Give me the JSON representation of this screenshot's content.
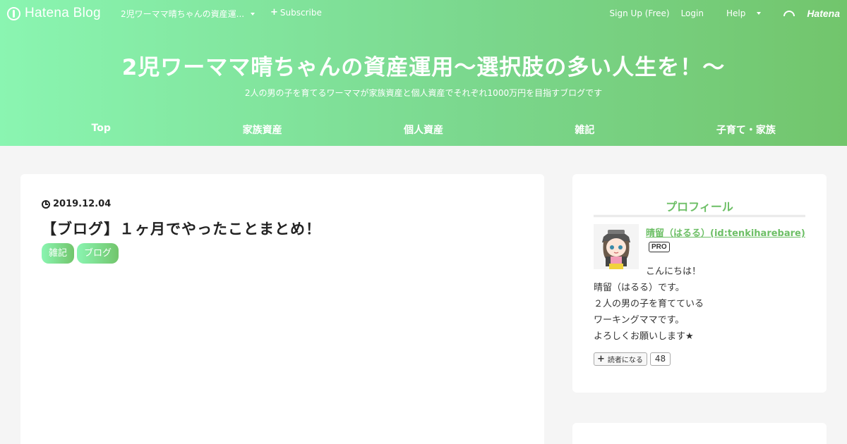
{
  "topbar": {
    "logo_text": "Hatena Blog",
    "blog_name": "2児ワーママ晴ちゃんの資産運...",
    "subscribe": "Subscribe",
    "signup": "Sign Up (Free)",
    "login": "Login",
    "help": "Help",
    "hatena": "Hatena"
  },
  "blog": {
    "title": "2児ワーママ晴ちゃんの資産運用～選択肢の多い人生を！～",
    "description": "2人の男の子を育てるワーママが家族資産と個人資産でそれぞれ1000万円を目指すブログです"
  },
  "nav": [
    "Top",
    "家族資産",
    "個人資産",
    "雑記",
    "子育て・家族"
  ],
  "post": {
    "date": "2019.12.04",
    "title": "【ブログ】１ヶ月でやったことまとめ！",
    "categories": [
      "雑記",
      "ブログ"
    ]
  },
  "profile": {
    "heading": "プロフィール",
    "name": "晴留（はるる）(id:tenkiharebare)",
    "badge": "PRO",
    "lines": [
      "こんにちは！",
      "晴留（はるる）です。",
      "２人の男の子を育てている",
      "ワーキングママです。",
      "よろしくお願いします★"
    ],
    "follow_label": "読者になる",
    "follow_count": "48"
  },
  "colors": {
    "gradient_start": "#8af5b1",
    "gradient_end": "#72c56c",
    "accent": "#6dbf66"
  }
}
